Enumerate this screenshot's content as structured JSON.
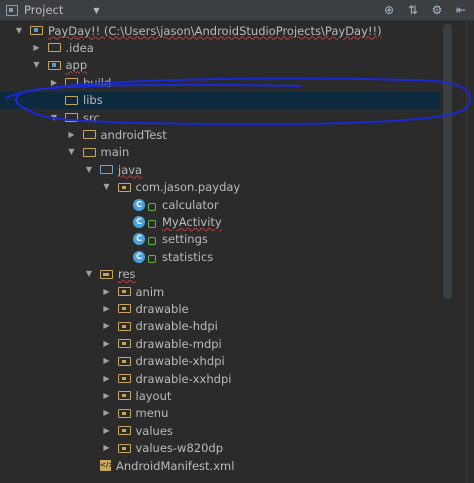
{
  "header": {
    "view_label": "Project",
    "tools": [
      "⊕",
      "⇅",
      "⚙",
      "⇤"
    ]
  },
  "tree": [
    {
      "label": "PayDay!! (C:\\Users\\jason\\AndroidStudioProjects\\PayDay!!)",
      "level": 0,
      "arrow": "down",
      "icon": "module-folder",
      "squiggle": true
    },
    {
      "label": ".idea",
      "level": 1,
      "arrow": "right",
      "icon": "folder"
    },
    {
      "label": "app",
      "level": 1,
      "arrow": "down",
      "icon": "module-folder",
      "squiggle": true
    },
    {
      "label": "build",
      "level": 2,
      "arrow": "right",
      "icon": "folder"
    },
    {
      "label": "libs",
      "level": 2,
      "arrow": "none",
      "icon": "folder",
      "selected": true
    },
    {
      "label": "src",
      "level": 2,
      "arrow": "down",
      "icon": "folder"
    },
    {
      "label": "androidTest",
      "level": 3,
      "arrow": "right",
      "icon": "folder"
    },
    {
      "label": "main",
      "level": 3,
      "arrow": "down",
      "icon": "folder"
    },
    {
      "label": "java",
      "level": 4,
      "arrow": "down",
      "icon": "source-folder",
      "squiggle": true
    },
    {
      "label": "com.jason.payday",
      "level": 5,
      "arrow": "down",
      "icon": "package-folder"
    },
    {
      "label": "calculator",
      "level": 6,
      "arrow": "none",
      "icon": "class"
    },
    {
      "label": "MyActivity",
      "level": 6,
      "arrow": "none",
      "icon": "class",
      "squiggle": true
    },
    {
      "label": "settings",
      "level": 6,
      "arrow": "none",
      "icon": "class"
    },
    {
      "label": "statistics",
      "level": 6,
      "arrow": "none",
      "icon": "class"
    },
    {
      "label": "res",
      "level": 4,
      "arrow": "down",
      "icon": "res-folder",
      "squiggle": true
    },
    {
      "label": "anim",
      "level": 5,
      "arrow": "right",
      "icon": "res-dir"
    },
    {
      "label": "drawable",
      "level": 5,
      "arrow": "right",
      "icon": "res-dir"
    },
    {
      "label": "drawable-hdpi",
      "level": 5,
      "arrow": "right",
      "icon": "res-dir"
    },
    {
      "label": "drawable-mdpi",
      "level": 5,
      "arrow": "right",
      "icon": "res-dir"
    },
    {
      "label": "drawable-xhdpi",
      "level": 5,
      "arrow": "right",
      "icon": "res-dir"
    },
    {
      "label": "drawable-xxhdpi",
      "level": 5,
      "arrow": "right",
      "icon": "res-dir"
    },
    {
      "label": "layout",
      "level": 5,
      "arrow": "right",
      "icon": "res-dir"
    },
    {
      "label": "menu",
      "level": 5,
      "arrow": "right",
      "icon": "res-dir"
    },
    {
      "label": "values",
      "level": 5,
      "arrow": "right",
      "icon": "res-dir"
    },
    {
      "label": "values-w820dp",
      "level": 5,
      "arrow": "right",
      "icon": "res-dir"
    },
    {
      "label": "AndroidManifest.xml",
      "level": 4,
      "arrow": "none",
      "icon": "xml-file"
    }
  ],
  "colors": {
    "background": "#2b2b2b",
    "header": "#3c3f41",
    "selection": "#0d293e",
    "annotation": "#1a2ad6",
    "class_icon": "#4aa1e0",
    "folder": "#c8a75c"
  },
  "annotation": {
    "shape": "hand-drawn ellipse",
    "around": "libs"
  }
}
